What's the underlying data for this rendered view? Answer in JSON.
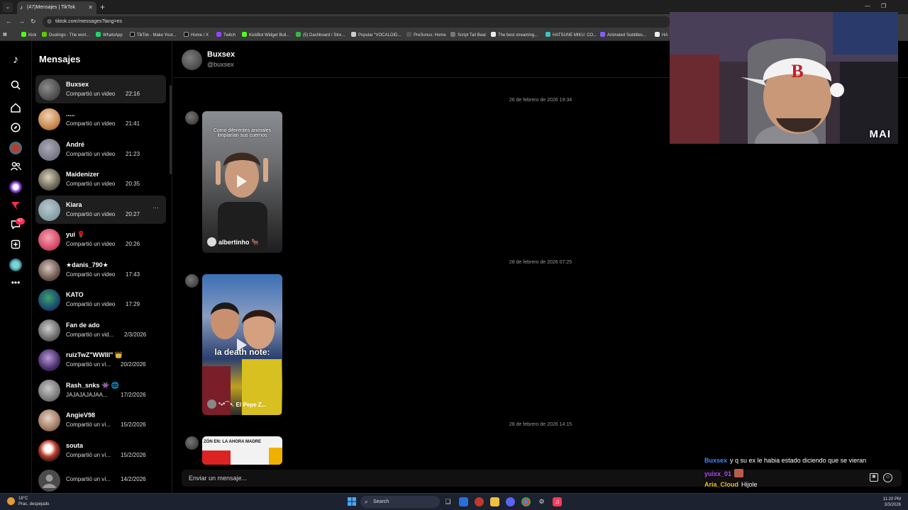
{
  "browser": {
    "tab_title": "(47)Mensajes | TikTok",
    "url": "tiktok.com/messages?lang=es",
    "bookmarks": [
      "Kick",
      "Duolingo - The worl...",
      "WhatsApp",
      "TikTok - Make Your...",
      "Home / X",
      "Twitch",
      "KickBot Widget Buil...",
      "(5) Dashboard / Stre...",
      "Popular \"VOCALOID...",
      "PreSonus: Home",
      "Script Tail Beat",
      "The best streaming...",
      "HATSUNE MIKU: CO...",
      "Animated Subtitles...",
      "HA"
    ]
  },
  "rail": {
    "notifications_badge": "47"
  },
  "conversations": {
    "title": "Mensajes",
    "items": [
      {
        "name": "Buxsex",
        "preview": "Compartió un video",
        "time": "22:16"
      },
      {
        "name": ".....",
        "preview": "Compartió un video",
        "time": "21:41"
      },
      {
        "name": "André",
        "preview": "Compartió un video",
        "time": "21:23"
      },
      {
        "name": "Maidenizer",
        "preview": "Compartió un video",
        "time": "20:35"
      },
      {
        "name": "Kiara",
        "preview": "Compartió un video",
        "time": "20:27"
      },
      {
        "name": "yui 🌹",
        "preview": "Compartió un video",
        "time": "20:26"
      },
      {
        "name": "★danis_790★",
        "preview": "Compartió un video",
        "time": "17:43"
      },
      {
        "name": "KATO",
        "preview": "Compartió un video",
        "time": "17:29"
      },
      {
        "name": "Fan de ado",
        "preview": "Compartió un vid...",
        "time": "2/3/2026"
      },
      {
        "name": "ruizTwZ\"WWIII\" 👑",
        "preview": "Compartió un ví...",
        "time": "20/2/2026"
      },
      {
        "name": "Rash_snks 👾 🌐",
        "preview": "JAJAJAJAJAA...",
        "time": "17/2/2026"
      },
      {
        "name": "AngieV98",
        "preview": "Compartió un ví...",
        "time": "15/2/2026"
      },
      {
        "name": "souta",
        "preview": "Compartió un ví...",
        "time": "15/2/2026"
      },
      {
        "name": "",
        "preview": "Compartió un ví...",
        "time": "14/2/2026"
      }
    ]
  },
  "chat": {
    "contact_name": "Buxsex",
    "contact_handle": "@buxsex",
    "messages": [
      {
        "date": "26 de febrero de 2026 19:34",
        "video_caption": "Como diferentes animales limpiarían sus cuernos",
        "author": "albertinho 🐂"
      },
      {
        "date": "28 de febrero de 2026 07:25",
        "video_caption": "la death note:",
        "author": "°•*⁀➷ El Pepe Z..."
      },
      {
        "date": "28 de febrero de 2026 14:15",
        "video_caption": "ZÓN EN:   LA AHORA MADRE",
        "author": ""
      }
    ],
    "composer_placeholder": "Enviar un mensaje..."
  },
  "stream_overlay": {
    "webcam_watermark": "MAI",
    "chat": [
      {
        "user": "Buxsex",
        "color": "#3d8bff",
        "text": "y q su ex le habia estado diciendo que se vieran"
      },
      {
        "user": "yuixx_01",
        "color": "#b44cff",
        "text": ""
      },
      {
        "user": "Aria_Cloud",
        "color": "#f0c419",
        "text": "Hijole"
      }
    ]
  },
  "taskbar": {
    "weather_temp": "18°C",
    "weather_desc": "Prac. despejado",
    "search_label": "Search",
    "time": "11:20 PM",
    "date": "3/3/2026"
  },
  "colors": {
    "accent": "#fe2c55",
    "background": "#000000",
    "active_row": "#1e1e1e"
  }
}
